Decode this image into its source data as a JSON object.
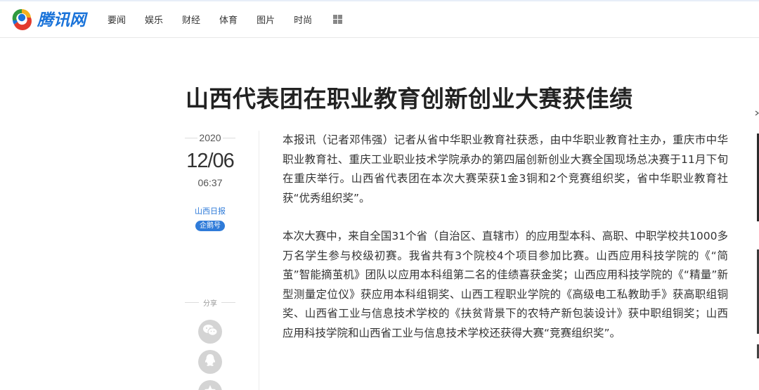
{
  "header": {
    "logo_text": "腾讯网",
    "nav": [
      "要闻",
      "娱乐",
      "财经",
      "体育",
      "图片",
      "时尚"
    ],
    "more_icon": "grid-icon"
  },
  "article": {
    "title": "山西代表团在职业教育创新创业大赛获佳绩",
    "year": "2020",
    "date": "12/06",
    "time": "06:37",
    "source": "山西日报",
    "badge": "企鹅号",
    "share_label": "分享",
    "share_icons": [
      "wechat-icon",
      "qq-icon",
      "qzone-icon"
    ],
    "paragraphs": [
      "本报讯（记者邓伟强）记者从省中华职业教育社获悉，由中华职业教育社主办，重庆市中华职业教育社、重庆工业职业技术学院承办的第四届创新创业大赛全国现场总决赛于11月下旬在重庆举行。山西省代表团在本次大赛荣获1金3铜和2个竞赛组织奖，省中华职业教育社获“优秀组织奖”。",
      "本次大赛中，来自全国31个省（自治区、直辖市）的应用型本科、高职、中职学校共1000多万名学生参与校级初赛。我省共有3个院校4个项目参加比赛。山西应用科技学院的《“简茧”智能摘茧机》团队以应用本科组第二名的佳绩喜获金奖；山西应用科技学院的《“精量”新型测量定位仪》获应用本科组铜奖、山西工程职业学院的《高级电工私教助手》获高职组铜奖、山西省工业与信息技术学校的《扶贫背景下的农特产新包装设计》获中职组铜奖；山西应用科技学院和山西省工业与信息技术学校还获得大赛“竞赛组织奖”。"
    ]
  },
  "colors": {
    "brand_blue": "#1a73d9",
    "badge_blue": "#2f7bd9",
    "share_gray": "#d4d4d4"
  }
}
